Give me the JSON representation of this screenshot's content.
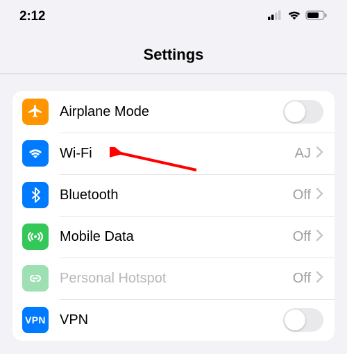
{
  "status": {
    "time": "2:12"
  },
  "header": {
    "title": "Settings"
  },
  "rows": {
    "airplane": {
      "label": "Airplane Mode"
    },
    "wifi": {
      "label": "Wi-Fi",
      "value": "AJ"
    },
    "bluetooth": {
      "label": "Bluetooth",
      "value": "Off"
    },
    "mobile": {
      "label": "Mobile Data",
      "value": "Off"
    },
    "hotspot": {
      "label": "Personal Hotspot",
      "value": "Off"
    },
    "vpn": {
      "label": "VPN",
      "badge": "VPN"
    }
  },
  "colors": {
    "airplane": "#ff9500",
    "wifi": "#007aff",
    "bluetooth": "#007aff",
    "mobile": "#34c759",
    "hotspot": "#9de0b4",
    "vpn": "#007aff"
  }
}
